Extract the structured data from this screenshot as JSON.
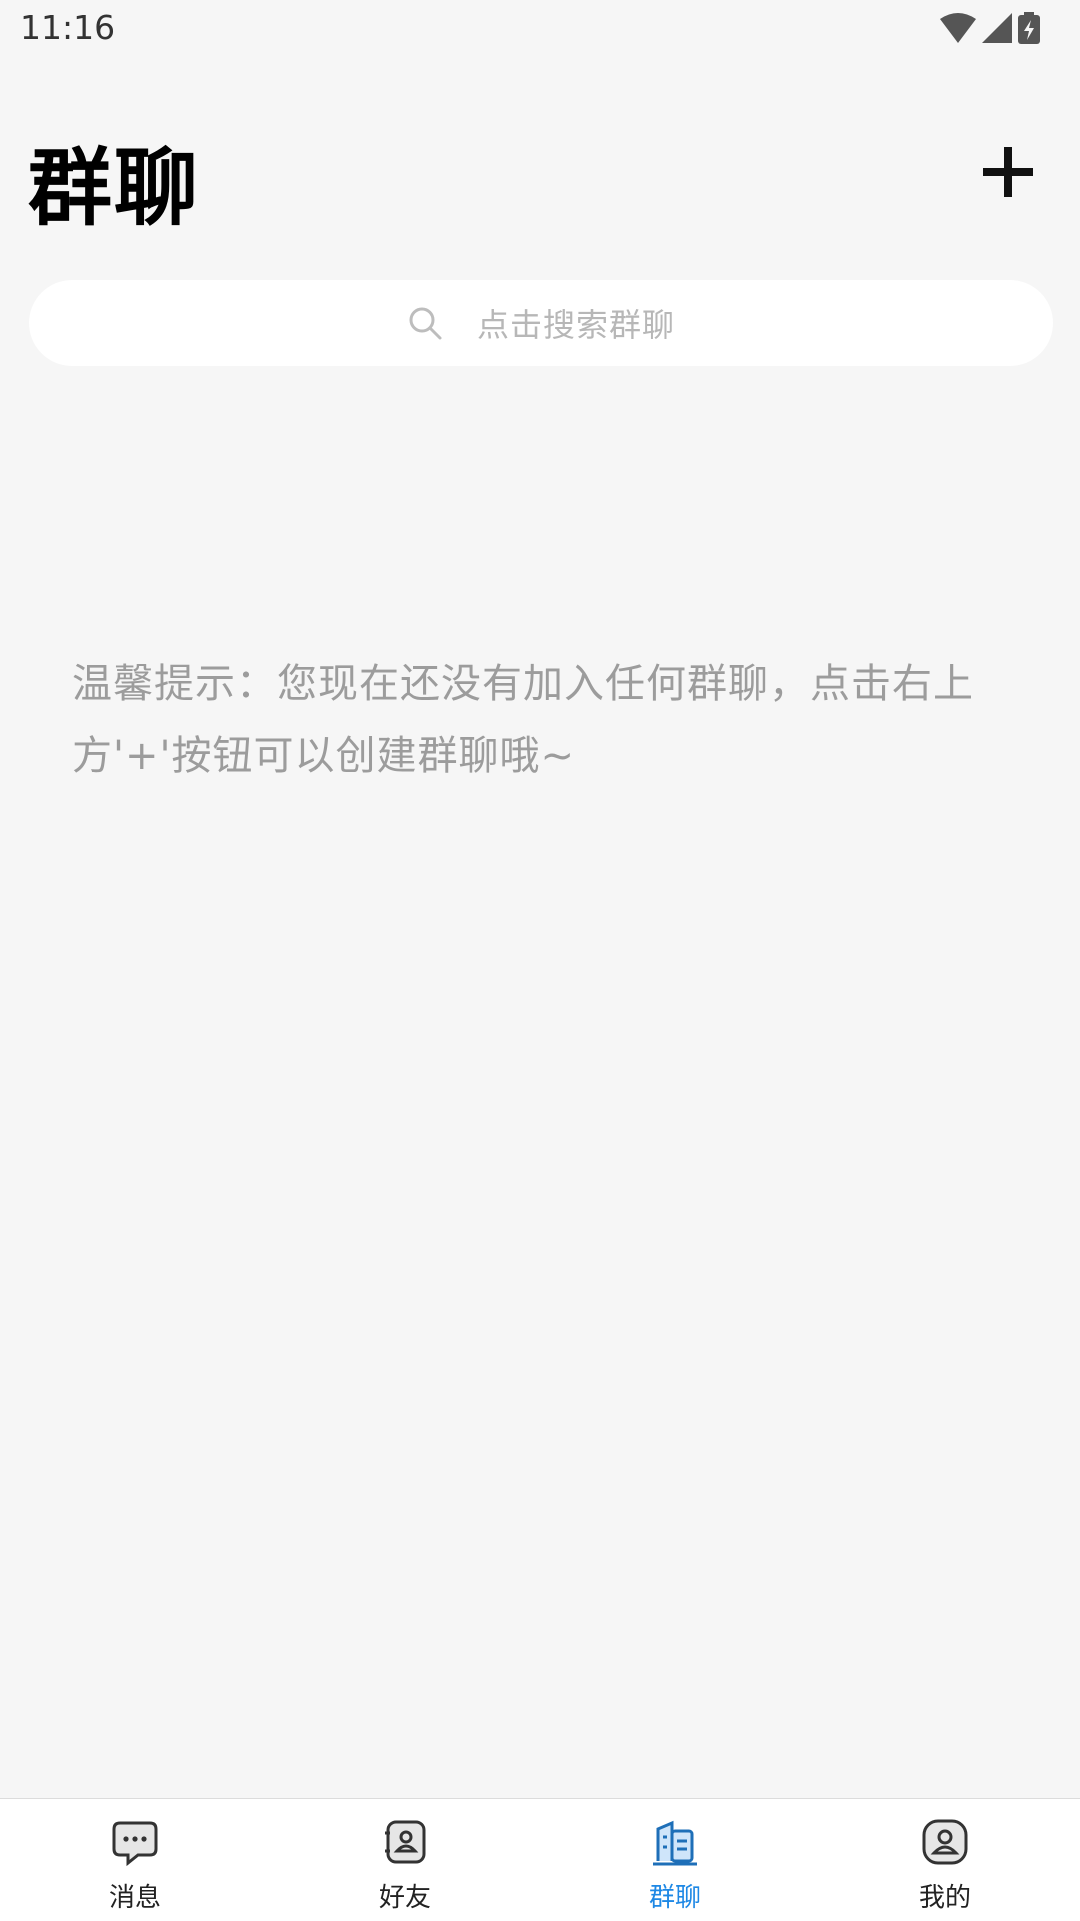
{
  "status_bar": {
    "time": "11:16",
    "icons": [
      "wifi-icon",
      "cellular-signal-icon",
      "battery-charging-icon"
    ]
  },
  "header": {
    "title": "群聊",
    "add_button_icon": "plus-icon"
  },
  "search": {
    "placeholder": "点击搜索群聊",
    "icon": "search-icon"
  },
  "empty_state": {
    "hint": "温馨提示：您现在还没有加入任何群聊，点击右上方'+'按钮可以创建群聊哦~"
  },
  "bottom_nav": {
    "items": [
      {
        "label": "消息",
        "icon": "chat-bubble-icon",
        "active": false
      },
      {
        "label": "好友",
        "icon": "contacts-icon",
        "active": false
      },
      {
        "label": "群聊",
        "icon": "group-chat-icon",
        "active": true
      },
      {
        "label": "我的",
        "icon": "profile-icon",
        "active": false
      }
    ]
  },
  "colors": {
    "background": "#f6f6f6",
    "accent": "#1e88e5",
    "hint_text": "#9c9c9c"
  }
}
